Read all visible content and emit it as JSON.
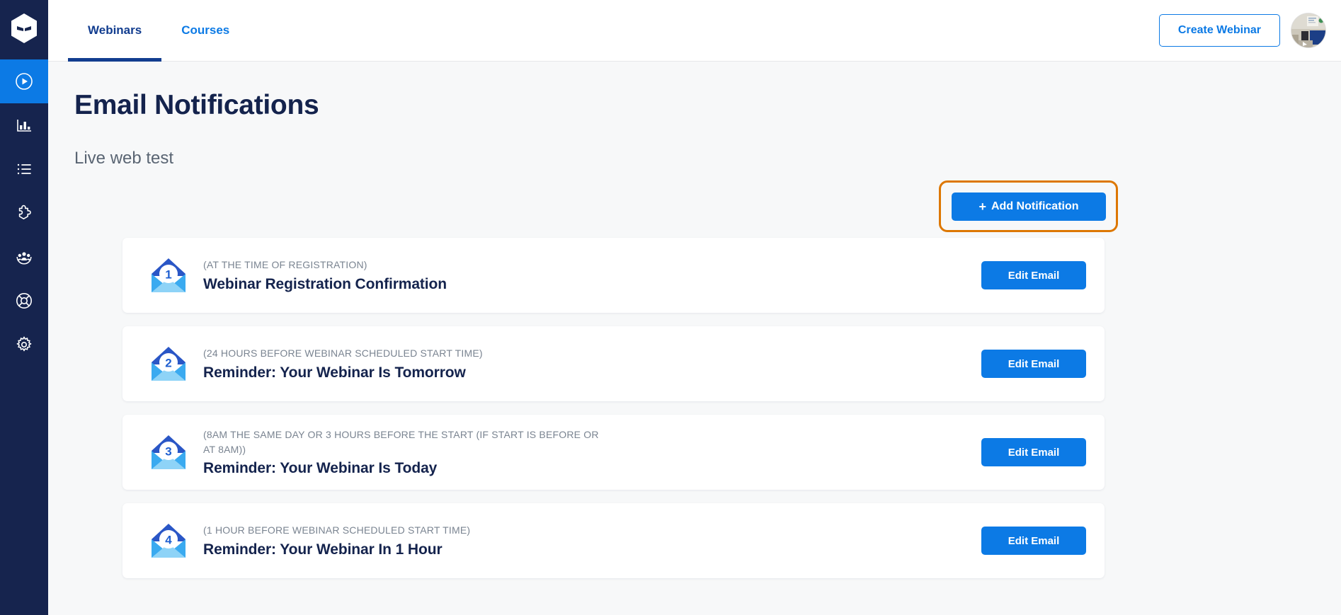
{
  "brand": {
    "logo_icon": "ninja-hexagon-logo",
    "navy": "#16244e",
    "accent_blue": "#0c7ae5",
    "active_tab_blue": "#123d8f",
    "highlight_orange": "#dd7700",
    "page_bg": "#f7f8f9",
    "card_bg": "#ffffff",
    "heading_color": "#14234d",
    "muted_text": "#7a8491"
  },
  "sidebar": {
    "items": [
      {
        "icon": "play-circle-icon",
        "name": "webinars",
        "active": true
      },
      {
        "icon": "bar-chart-icon",
        "name": "analytics",
        "active": false
      },
      {
        "icon": "list-icon",
        "name": "list",
        "active": false
      },
      {
        "icon": "puzzle-piece-icon",
        "name": "integrations",
        "active": false
      },
      {
        "icon": "users-group-icon",
        "name": "contacts",
        "active": false
      },
      {
        "icon": "lifebuoy-icon",
        "name": "support",
        "active": false
      },
      {
        "icon": "gear-icon",
        "name": "settings",
        "active": false
      }
    ]
  },
  "topbar": {
    "tabs": [
      {
        "label": "Webinars",
        "active": true
      },
      {
        "label": "Courses",
        "active": false
      }
    ],
    "create_button": "Create Webinar",
    "avatar_alt": "user-avatar-photo"
  },
  "page": {
    "title": "Email Notifications",
    "subtitle": "Live web test",
    "add_notification_label": "Add Notification",
    "add_notification_plus": "+"
  },
  "notifications": [
    {
      "number": "1",
      "when": "(AT THE TIME OF REGISTRATION)",
      "name": "Webinar Registration Confirmation",
      "action_label": "Edit Email"
    },
    {
      "number": "2",
      "when": "(24 HOURS BEFORE WEBINAR SCHEDULED START TIME)",
      "name": "Reminder: Your Webinar Is Tomorrow",
      "action_label": "Edit Email"
    },
    {
      "number": "3",
      "when": "(8AM THE SAME DAY OR 3 HOURS BEFORE THE START (IF START IS BEFORE OR AT 8AM))",
      "name": "Reminder: Your Webinar Is Today",
      "action_label": "Edit Email"
    },
    {
      "number": "4",
      "when": "(1 HOUR BEFORE WEBINAR SCHEDULED START TIME)",
      "name": "Reminder: Your Webinar In 1 Hour",
      "action_label": "Edit Email"
    }
  ]
}
